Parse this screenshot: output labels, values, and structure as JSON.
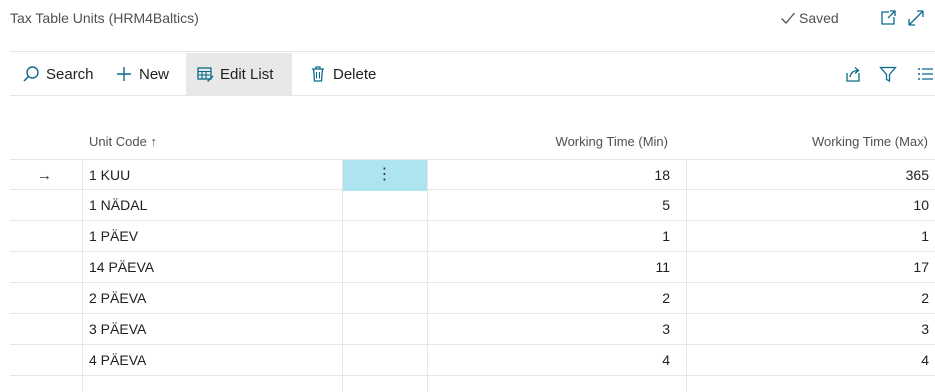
{
  "page": {
    "title": "Tax Table Units (HRM4Baltics)",
    "saved_label": "Saved"
  },
  "actions": {
    "search": "Search",
    "new": "New",
    "edit_list": "Edit List",
    "delete": "Delete"
  },
  "columns": {
    "unit_code": "Unit Code",
    "sort_indicator": "↑",
    "min": "Working Time (Min)",
    "max": "Working Time (Max)"
  },
  "rows": [
    {
      "code": "1 KUU",
      "min": "18",
      "max": "365",
      "selected": true
    },
    {
      "code": "1 NÄDAL",
      "min": "5",
      "max": "10"
    },
    {
      "code": "1 PÄEV",
      "min": "1",
      "max": "1"
    },
    {
      "code": "14 PÄEVA",
      "min": "11",
      "max": "17"
    },
    {
      "code": "2 PÄEVA",
      "min": "2",
      "max": "2"
    },
    {
      "code": "3 PÄEVA",
      "min": "3",
      "max": "3"
    },
    {
      "code": "4 PÄEVA",
      "min": "4",
      "max": "4"
    }
  ],
  "selected_row_marker": "→",
  "row_menu_glyph": "⋮",
  "colors": {
    "accent": "#0b6a8c",
    "selected_cell": "#aee4ef",
    "active_action_bg": "#e8e8e8"
  }
}
